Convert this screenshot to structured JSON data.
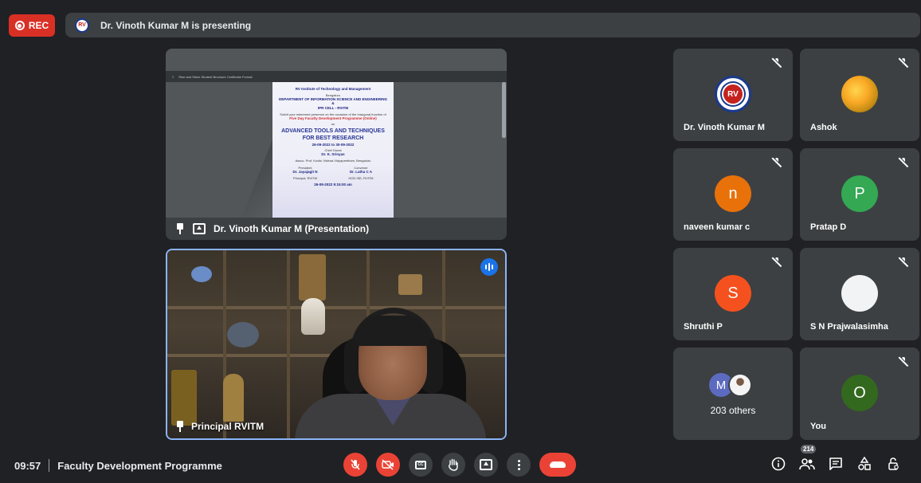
{
  "top_bar": {
    "rec_label": "REC",
    "presenting_text": "Dr. Vinoth Kumar M is presenting",
    "presenter_logo_text": "RV"
  },
  "presentation": {
    "label": "Dr. Vinoth Kumar M (Presentation)",
    "pdf_toolbar_title": "Rise and Shine Student Brochure Certificate Format",
    "slide": {
      "institution": "RV Institute of Technology and Management",
      "city": "Bengaluru",
      "department": "DEPARTMENT OF INFORMATION SCIENCE AND ENGINEERING",
      "and": "&",
      "cell": "IPR CELL - RVITM",
      "invite": "Solicit your esteemed presence on the occasion of the Inaugural function of",
      "programme": "Five Day Faculty Development Programme (Online)",
      "on": "on",
      "topic": "ADVANCED TOOLS AND TECHNIQUES FOR BEST RESEARCH",
      "dates": "26-09-2022 to 30-09-2022",
      "chief_guest_label": "Chief Guest",
      "chief_guest": "Dr. K. Srinyas",
      "chief_guest_role": "Assoc. Prof, Kuvitu Vishwa Vidyapeetham, Bengaluru",
      "president_label": "President",
      "president": "Dr. Jayajagit N",
      "president_role": "Principal, RVITM",
      "convener_label": "Convener",
      "convener": "Dr. Latha C A",
      "convener_role": "HOD ISE, RVITM",
      "time": "26-09-2022 9:15:00 am"
    }
  },
  "main_video": {
    "label": "Principal RVITM"
  },
  "participants": [
    {
      "name": "Dr. Vinoth Kumar M",
      "avatar_type": "logo",
      "avatar_text": "RV"
    },
    {
      "name": "Ashok",
      "avatar_type": "photo",
      "avatar_text": ""
    },
    {
      "name": "naveen kumar c",
      "avatar_type": "letter",
      "avatar_text": "n",
      "color": "#e8710a"
    },
    {
      "name": "Pratap D",
      "avatar_type": "letter",
      "avatar_text": "P",
      "color": "#34a853"
    },
    {
      "name": "Shruthi P",
      "avatar_type": "letter",
      "avatar_text": "S",
      "color": "#f4511e"
    },
    {
      "name": "S N Prajwalasimha",
      "avatar_type": "blank",
      "avatar_text": ""
    },
    {
      "name": "203 others",
      "avatar_type": "group",
      "avatar_text": "M"
    },
    {
      "name": "You",
      "avatar_type": "letter",
      "avatar_text": "O",
      "color": "#33691e"
    }
  ],
  "bottom_bar": {
    "time": "09:57",
    "meeting_title": "Faculty Development Programme",
    "cc_label": "CC",
    "participant_count": "214"
  },
  "icons": {
    "info": "info-icon",
    "people": "people-icon",
    "chat": "chat-icon",
    "activities": "activities-icon",
    "host_controls": "host-controls-icon"
  },
  "colors": {
    "background": "#202124",
    "tile": "#3c4043",
    "rec_red": "#d93025",
    "speaking_blue": "#1a73e8",
    "active_border": "#8ab4f8"
  }
}
